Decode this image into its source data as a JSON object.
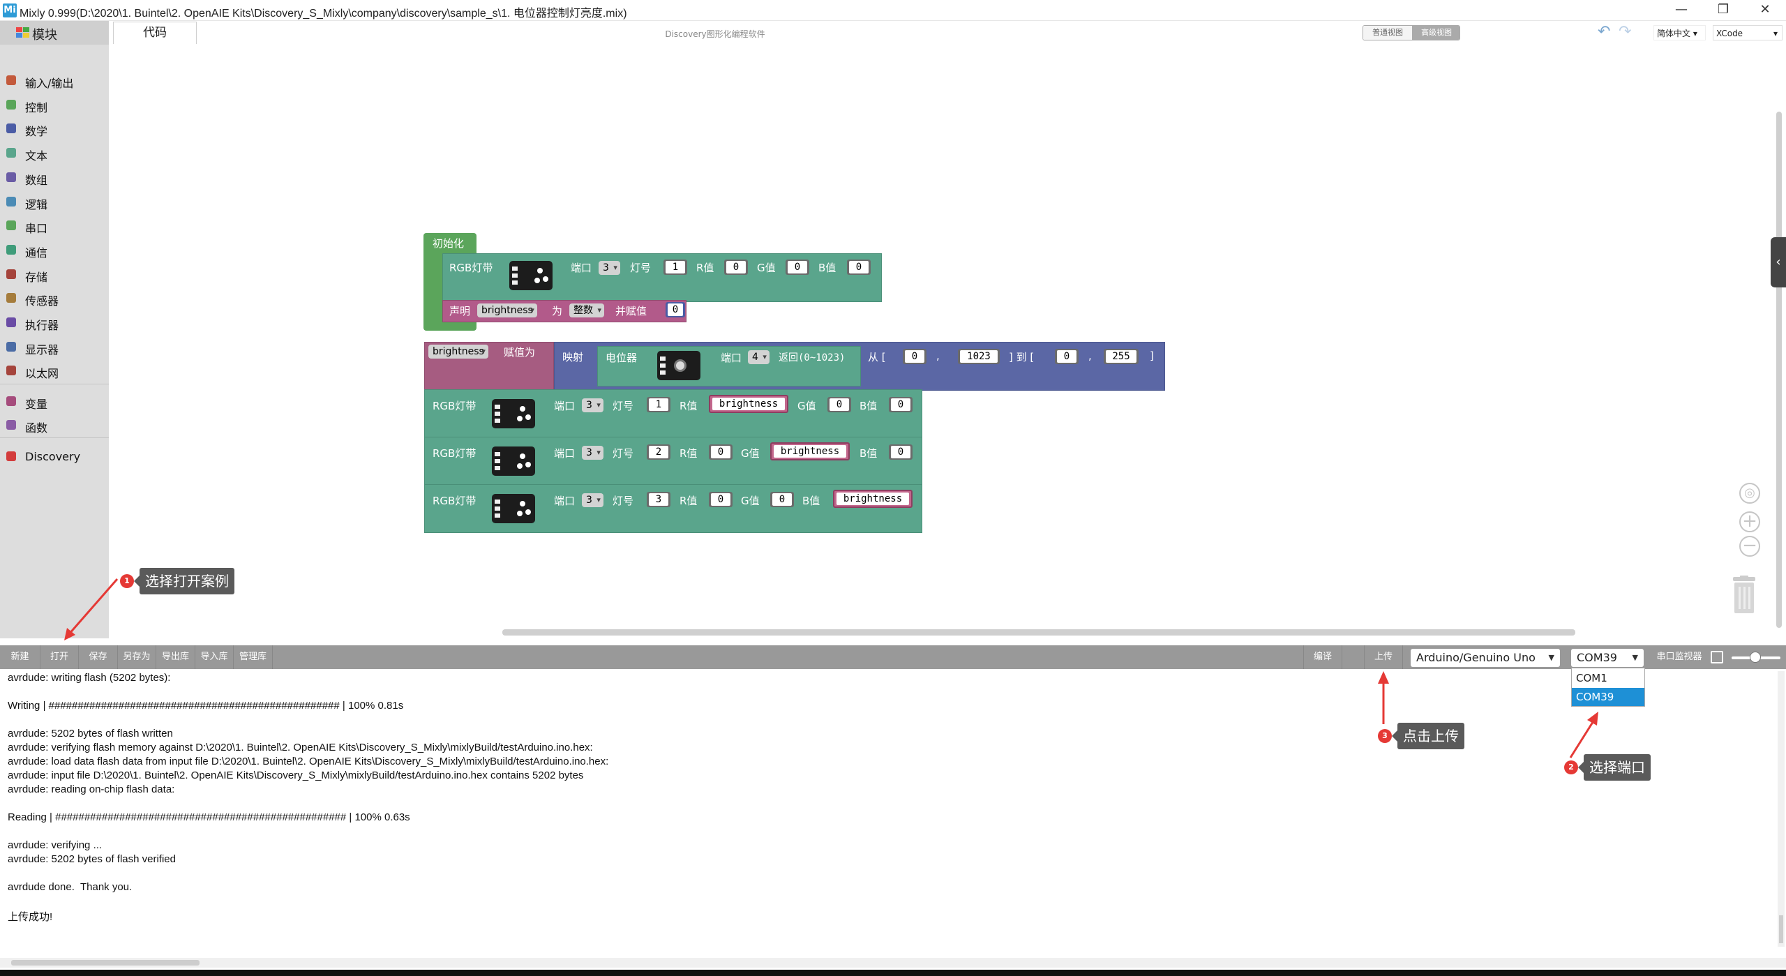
{
  "window": {
    "title": "Mixly 0.999(D:\\2020\\1. Buintel\\2. OpenAIE Kits\\Discovery_S_Mixly\\company\\discovery\\sample_s\\1. 电位器控制灯亮度.mix)",
    "app_icon": "Mi",
    "minimize": "—",
    "maximize": "❐",
    "close": "✕"
  },
  "sidebar": {
    "header": "模块",
    "items": [
      {
        "label": "输入/输出",
        "icon": "io-icon",
        "color": "#c35a3c"
      },
      {
        "label": "控制",
        "icon": "control-icon",
        "color": "#5aa55a"
      },
      {
        "label": "数学",
        "icon": "math-icon",
        "color": "#4b5ca5"
      },
      {
        "label": "文本",
        "icon": "text-icon",
        "color": "#5aa58c"
      },
      {
        "label": "数组",
        "icon": "array-icon",
        "color": "#6a5ca5"
      },
      {
        "label": "逻辑",
        "icon": "logic-icon",
        "color": "#4b8bb5"
      },
      {
        "label": "串口",
        "icon": "serial-icon",
        "color": "#5aa55a"
      },
      {
        "label": "通信",
        "icon": "comm-icon",
        "color": "#3f9c7a"
      },
      {
        "label": "存储",
        "icon": "storage-icon",
        "color": "#a5443c"
      },
      {
        "label": "传感器",
        "icon": "sensor-icon",
        "color": "#a57c3c"
      },
      {
        "label": "执行器",
        "icon": "actuator-icon",
        "color": "#6a4ca5"
      },
      {
        "label": "显示器",
        "icon": "display-icon",
        "color": "#4b6ca5"
      },
      {
        "label": "以太网",
        "icon": "ethernet-icon",
        "color": "#a5443c"
      },
      {
        "label": "变量",
        "icon": "variable-icon",
        "color": "#a54c7c"
      },
      {
        "label": "函数",
        "icon": "function-icon",
        "color": "#8a5ca5"
      },
      {
        "label": "Discovery",
        "icon": "discovery-icon",
        "color": "#d33c3c"
      }
    ]
  },
  "tabs": {
    "code": "代码"
  },
  "caption": "Discovery图形化编程软件",
  "view_switch": {
    "normal": "普通视图",
    "advanced": "高级视图"
  },
  "language": "简体中文",
  "theme": "XCode",
  "blocks": {
    "init": "初始化",
    "rgb_strip": "RGB灯带",
    "port": "端口",
    "lamp_no": "灯号",
    "r_val": "R值",
    "g_val": "G值",
    "b_val": "B值",
    "declare": "声明",
    "as": "为",
    "type_int": "整数",
    "and_assign": "并赋值",
    "brightness": "brightness",
    "assign_to": "赋值为",
    "map": "映射",
    "potentiometer": "电位器",
    "returns": "返回(0~1023)",
    "from": "从 [",
    "comma": ",",
    "to": "] 到 [",
    "close_bracket": "]",
    "values": {
      "port3": "3",
      "port4": "4",
      "zero": "0",
      "one": "1",
      "two": "2",
      "three": "3",
      "max_in": "1023",
      "max_out": "255"
    }
  },
  "annotations": [
    {
      "num": "1",
      "text": "选择打开案例"
    },
    {
      "num": "2",
      "text": "选择端口"
    },
    {
      "num": "3",
      "text": "点击上传"
    }
  ],
  "toolbar": {
    "new": "新建",
    "open": "打开",
    "save": "保存",
    "save_as": "另存为",
    "export_lib": "导出库",
    "import_lib": "导入库",
    "manage_lib": "管理库",
    "compile": "编译",
    "upload": "上传",
    "board": "Arduino/Genuino Uno",
    "port": "COM39",
    "serial_monitor": "串口监视器"
  },
  "port_options": [
    "COM1",
    "COM39"
  ],
  "console": {
    "lines": [
      "avrdude: writing flash (5202 bytes):",
      "",
      "Writing | ################################################## | 100% 0.81s",
      "",
      "avrdude: 5202 bytes of flash written",
      "avrdude: verifying flash memory against D:\\2020\\1. Buintel\\2. OpenAIE Kits\\Discovery_S_Mixly\\mixlyBuild/testArduino.ino.hex:",
      "avrdude: load data flash data from input file D:\\2020\\1. Buintel\\2. OpenAIE Kits\\Discovery_S_Mixly\\mixlyBuild/testArduino.ino.hex:",
      "avrdude: input file D:\\2020\\1. Buintel\\2. OpenAIE Kits\\Discovery_S_Mixly\\mixlyBuild/testArduino.ino.hex contains 5202 bytes",
      "avrdude: reading on-chip flash data:",
      "",
      "Reading | ################################################## | 100% 0.63s",
      "",
      "avrdude: verifying ...",
      "avrdude: 5202 bytes of flash verified",
      "",
      "avrdude done.  Thank you.",
      "",
      "上传成功!"
    ]
  }
}
